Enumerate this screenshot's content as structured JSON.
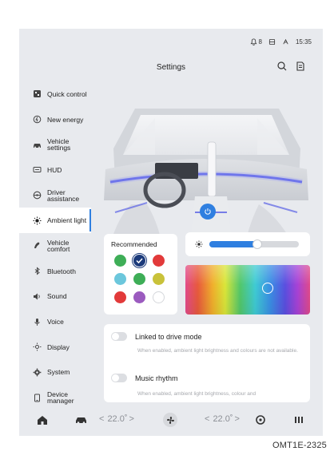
{
  "status_bar": {
    "bell_count": "8",
    "time": "15:35"
  },
  "header": {
    "title": "Settings"
  },
  "sidebar": {
    "items": [
      {
        "icon": "quick-control-icon",
        "label": "Quick control"
      },
      {
        "icon": "new-energy-icon",
        "label": "New energy"
      },
      {
        "icon": "car-icon",
        "label": "Vehicle settings"
      },
      {
        "icon": "hud-icon",
        "label": "HUD"
      },
      {
        "icon": "steering-wheel-icon",
        "label": "Driver assistance"
      },
      {
        "icon": "ambient-light-icon",
        "label": "Ambient light",
        "active": true
      },
      {
        "icon": "seat-icon",
        "label": "Vehicle comfort"
      },
      {
        "icon": "bluetooth-icon",
        "label": "Bluetooth"
      },
      {
        "icon": "speaker-icon",
        "label": "Sound"
      },
      {
        "icon": "microphone-icon",
        "label": "Voice"
      },
      {
        "icon": "display-icon",
        "label": "Display"
      },
      {
        "icon": "gear-icon",
        "label": "System"
      },
      {
        "icon": "device-icon",
        "label": "Device manager"
      }
    ]
  },
  "recommended": {
    "title": "Recommended",
    "colors": [
      "#3eae57",
      "#1b3a7a",
      "#e23a3a",
      "#6cc7dc",
      "#3eae57",
      "#c9c23a",
      "#e23a3a",
      "#9b5bbf",
      "#ffffff"
    ],
    "selected_index": 1
  },
  "brightness": {
    "level": 0.54
  },
  "palette": {
    "selected_hue": "#3a8fe4"
  },
  "toggles": [
    {
      "label": "Linked to drive mode",
      "on": false,
      "description": "When enabled, ambient light brightness and colours are not available."
    },
    {
      "label": "Music rhythm",
      "on": false,
      "description": "When enabled, ambient light brightness, colour and"
    }
  ],
  "dock": {
    "left_temp": "22.0˚",
    "right_temp": "22.0˚"
  },
  "figure_code": "OMT1E-2325",
  "colors": {
    "accent": "#2f7fe0",
    "background": "#e8eaee",
    "ambient_glow": "#5a62e6"
  }
}
